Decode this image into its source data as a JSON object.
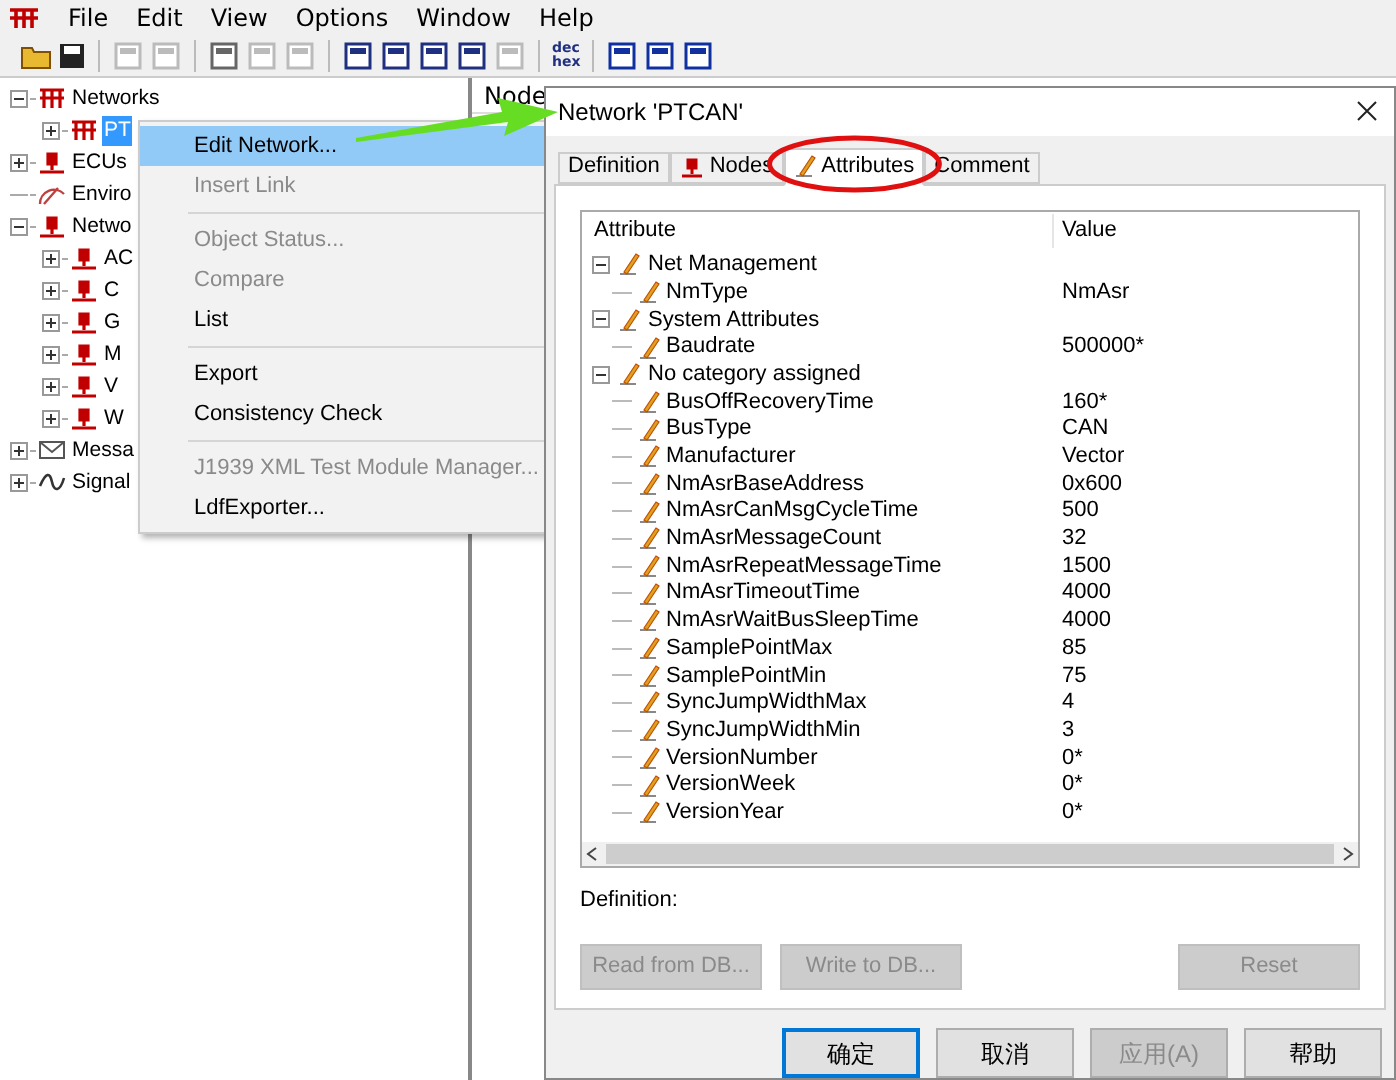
{
  "menu_bar": [
    "File",
    "Edit",
    "View",
    "Options",
    "Window",
    "Help"
  ],
  "toolbar": {
    "dec_hex": [
      "dec",
      "hex"
    ]
  },
  "tree": [
    {
      "label": "Networks",
      "kind": "network",
      "expanded": true,
      "selected": false,
      "children": [
        {
          "label": "PT",
          "kind": "network",
          "expanded": false,
          "selected": true
        }
      ]
    },
    {
      "label": "ECUs",
      "kind": "node",
      "expanded": false,
      "selected": false
    },
    {
      "label": "Enviro",
      "kind": "gauge",
      "selected": false
    },
    {
      "label": "Netwo",
      "kind": "node",
      "expanded": true,
      "selected": false,
      "children": [
        {
          "label": "AC",
          "kind": "node",
          "expanded": false,
          "selected": false
        },
        {
          "label": "C",
          "kind": "node",
          "expanded": false,
          "selected": false
        },
        {
          "label": "G",
          "kind": "node",
          "expanded": false,
          "selected": false
        },
        {
          "label": "M",
          "kind": "node",
          "expanded": false,
          "selected": false
        },
        {
          "label": "V",
          "kind": "node",
          "expanded": false,
          "selected": false
        },
        {
          "label": "W",
          "kind": "node",
          "expanded": false,
          "selected": false
        }
      ]
    },
    {
      "label": "Messa",
      "kind": "message",
      "expanded": false,
      "selected": false
    },
    {
      "label": "Signal",
      "kind": "signal",
      "expanded": false,
      "selected": false
    }
  ],
  "right_pane": {
    "column_1": "Node"
  },
  "context_menu": [
    {
      "kind": "item",
      "label": "Edit Network...",
      "disabled": false,
      "selected": true
    },
    {
      "kind": "item",
      "label": "Insert Link",
      "disabled": true,
      "selected": false
    },
    {
      "kind": "separator"
    },
    {
      "kind": "item",
      "label": "Object Status...",
      "disabled": true,
      "selected": false
    },
    {
      "kind": "item",
      "label": "Compare",
      "disabled": true,
      "selected": false
    },
    {
      "kind": "item",
      "label": "List",
      "disabled": false,
      "selected": false
    },
    {
      "kind": "separator"
    },
    {
      "kind": "item",
      "label": "Export",
      "disabled": false,
      "selected": false
    },
    {
      "kind": "item",
      "label": "Consistency Check",
      "disabled": false,
      "selected": false
    },
    {
      "kind": "separator"
    },
    {
      "kind": "item",
      "label": "J1939 XML Test Module Manager...",
      "disabled": true,
      "selected": false
    },
    {
      "kind": "item",
      "label": "LdfExporter...",
      "disabled": false,
      "selected": false
    }
  ],
  "dialog": {
    "title": "Network 'PTCAN'",
    "tabs": [
      {
        "label": "Definition",
        "kind": "plain",
        "selected": false
      },
      {
        "label": "Nodes",
        "kind": "node",
        "selected": false
      },
      {
        "label": "Attributes",
        "kind": "attribute",
        "selected": true,
        "circled": true
      },
      {
        "label": "Comment",
        "kind": "plain",
        "selected": false
      }
    ],
    "columns": [
      "Attribute",
      "Value"
    ],
    "attributes": [
      {
        "name": "Net Management",
        "expanded": true,
        "children": [
          {
            "name": "NmType",
            "value": "NmAsr"
          }
        ]
      },
      {
        "name": "System Attributes",
        "expanded": true,
        "children": [
          {
            "name": "Baudrate",
            "value": "500000*"
          }
        ]
      },
      {
        "name": "No category assigned",
        "expanded": true,
        "children": [
          {
            "name": "BusOffRecoveryTime",
            "value": "160*"
          },
          {
            "name": "BusType",
            "value": "CAN"
          },
          {
            "name": "Manufacturer",
            "value": "Vector"
          },
          {
            "name": "NmAsrBaseAddress",
            "value": "0x600"
          },
          {
            "name": "NmAsrCanMsgCycleTime",
            "value": "500"
          },
          {
            "name": "NmAsrMessageCount",
            "value": "32"
          },
          {
            "name": "NmAsrRepeatMessageTime",
            "value": "1500"
          },
          {
            "name": "NmAsrTimeoutTime",
            "value": "4000"
          },
          {
            "name": "NmAsrWaitBusSleepTime",
            "value": "4000"
          },
          {
            "name": "SamplePointMax",
            "value": "85"
          },
          {
            "name": "SamplePointMin",
            "value": "75"
          },
          {
            "name": "SyncJumpWidthMax",
            "value": "4"
          },
          {
            "name": "SyncJumpWidthMin",
            "value": "3"
          },
          {
            "name": "VersionNumber",
            "value": "0*"
          },
          {
            "name": "VersionWeek",
            "value": "0*"
          },
          {
            "name": "VersionYear",
            "value": "0*"
          }
        ]
      }
    ],
    "definition_label": "Definition:",
    "actions": [
      {
        "label": "Read from DB...",
        "disabled": true
      },
      {
        "label": "Write to DB...",
        "disabled": true
      },
      {
        "label": "Reset",
        "disabled": true
      }
    ],
    "buttons": [
      {
        "label": "确定",
        "disabled": false,
        "default": true
      },
      {
        "label": "取消",
        "disabled": false,
        "default": false
      },
      {
        "label": "应用(A)",
        "disabled": true,
        "default": false
      },
      {
        "label": "帮助",
        "disabled": false,
        "default": false
      }
    ]
  }
}
